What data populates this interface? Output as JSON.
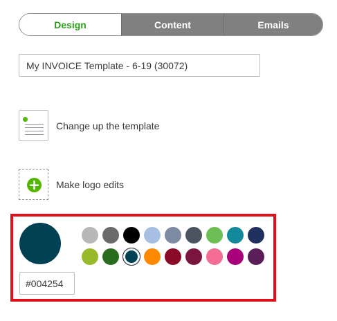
{
  "tabs": [
    {
      "label": "Design",
      "active": true
    },
    {
      "label": "Content",
      "active": false
    },
    {
      "label": "Emails",
      "active": false
    }
  ],
  "template_name": {
    "value": "My INVOICE Template - 6-19 (30072)"
  },
  "options": [
    {
      "label": "Change up the template",
      "icon": "template-thumbnail-icon"
    },
    {
      "label": "Make logo edits",
      "icon": "add-logo-icon"
    }
  ],
  "color_picker": {
    "selected_hex": "#004254",
    "preview_color": "#004254",
    "swatches": [
      "#b8b8b8",
      "#6b6b6b",
      "#000000",
      "#a7bfe0",
      "#7e8aa2",
      "#4a5560",
      "#6dbe55",
      "#138a9c",
      "#20305f",
      "#98ba2a",
      "#2b6d1f",
      "#004254",
      "#ff8a00",
      "#8a0a28",
      "#7a163e",
      "#f36d94",
      "#a8007a",
      "#5a1f58"
    ],
    "selected_index": 11
  },
  "colors": {
    "accent_green": "#2ca01c",
    "highlight_red": "#e0101a",
    "tab_inactive": "#808080"
  }
}
